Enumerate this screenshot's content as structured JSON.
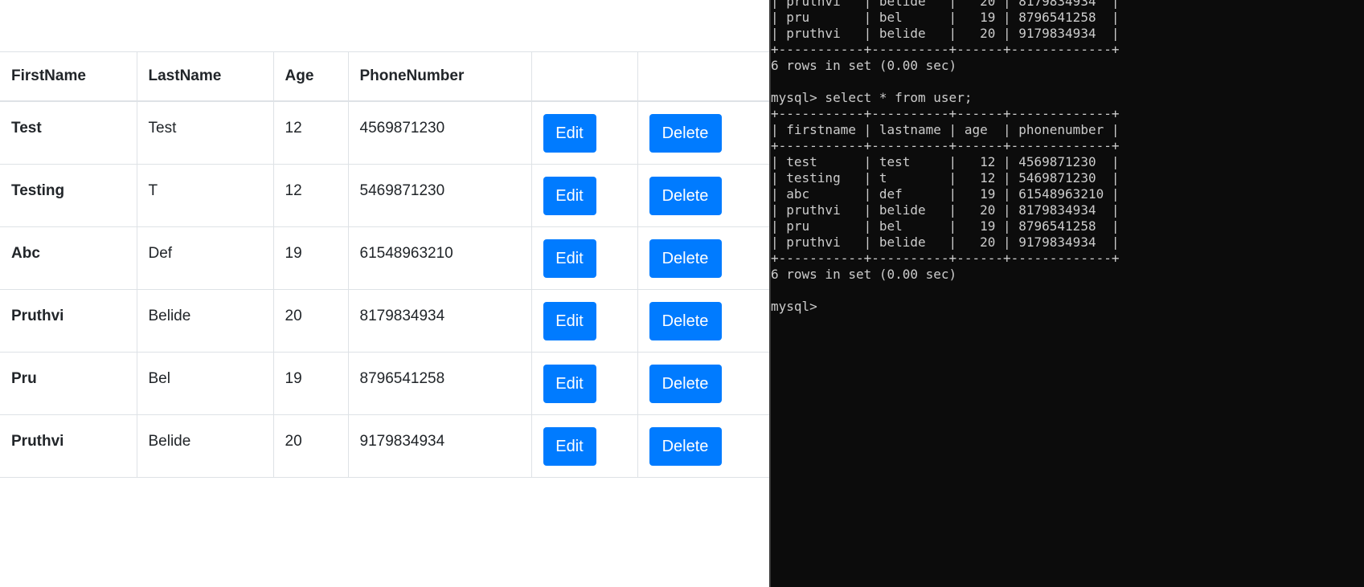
{
  "table": {
    "headers": [
      "FirstName",
      "LastName",
      "Age",
      "PhoneNumber",
      "",
      ""
    ],
    "edit_label": "Edit",
    "delete_label": "Delete",
    "rows": [
      {
        "first": "Test",
        "last": "Test",
        "age": "12",
        "phone": "4569871230"
      },
      {
        "first": "Testing",
        "last": "T",
        "age": "12",
        "phone": "5469871230"
      },
      {
        "first": "Abc",
        "last": "Def",
        "age": "19",
        "phone": "61548963210"
      },
      {
        "first": "Pruthvi",
        "last": "Belide",
        "age": "20",
        "phone": "8179834934"
      },
      {
        "first": "Pru",
        "last": "Bel",
        "age": "19",
        "phone": "8796541258"
      },
      {
        "first": "Pruthvi",
        "last": "Belide",
        "age": "20",
        "phone": "9179834934"
      }
    ]
  },
  "terminal": {
    "lines": [
      "| pruthvi   | belide   |   20 | 8179834934  |",
      "| pru       | bel      |   19 | 8796541258  |",
      "| pruthvi   | belide   |   20 | 9179834934  |",
      "+-----------+----------+------+-------------+",
      "6 rows in set (0.00 sec)",
      "",
      "mysql> select * from user;",
      "+-----------+----------+------+-------------+",
      "| firstname | lastname | age  | phonenumber |",
      "+-----------+----------+------+-------------+",
      "| test      | test     |   12 | 4569871230  |",
      "| testing   | t        |   12 | 5469871230  |",
      "| abc       | def      |   19 | 61548963210 |",
      "| pruthvi   | belide   |   20 | 8179834934  |",
      "| pru       | bel      |   19 | 8796541258  |",
      "| pruthvi   | belide   |   20 | 9179834934  |",
      "+-----------+----------+------+-------------+",
      "6 rows in set (0.00 sec)",
      "",
      "mysql> "
    ]
  },
  "colors": {
    "button_primary": "#007bff",
    "terminal_bg": "#0c0c0c",
    "terminal_fg": "#cccccc",
    "table_border": "#dee2e6"
  }
}
